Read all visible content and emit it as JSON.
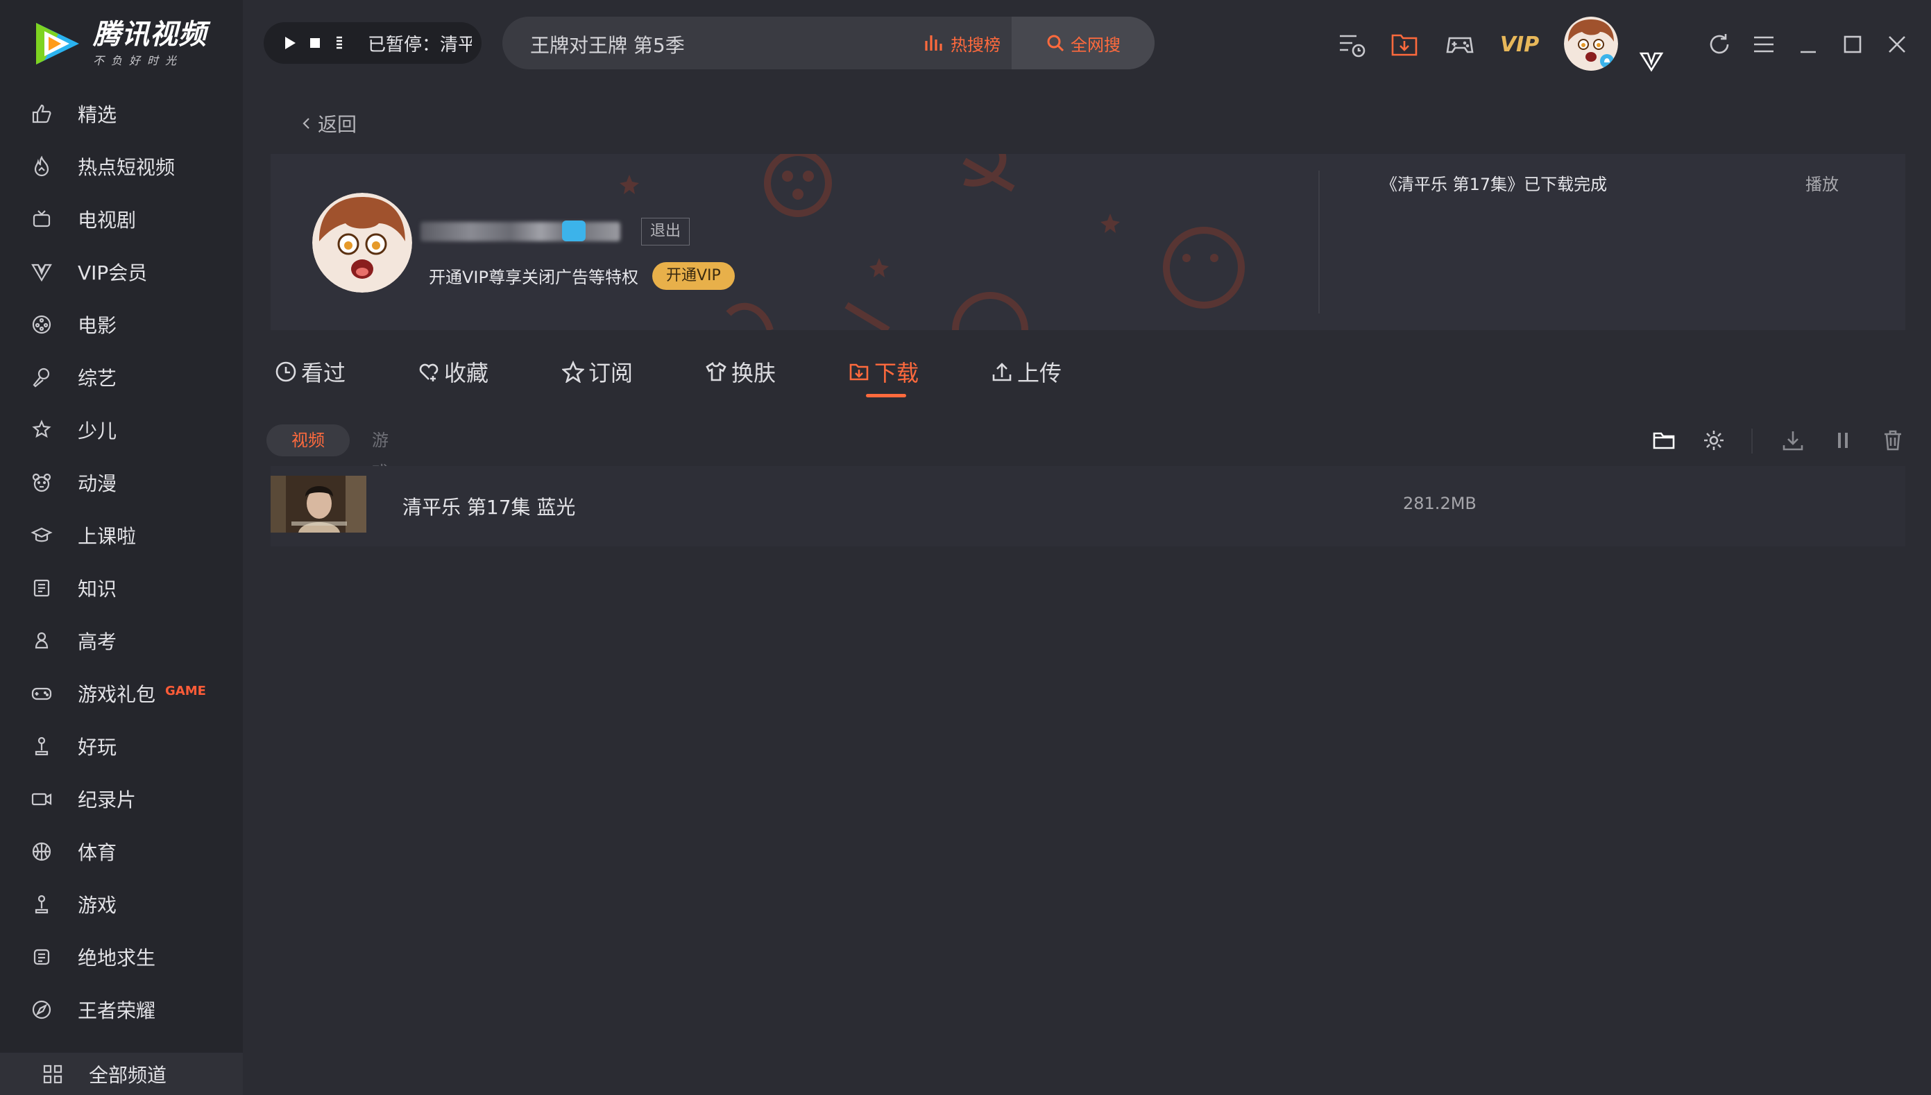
{
  "app": {
    "logo_name": "腾讯视频",
    "logo_slogan": "不负好时光"
  },
  "sidebar": {
    "items": [
      {
        "label": "精选",
        "icon": "thumbs-up-icon"
      },
      {
        "label": "热点短视频",
        "icon": "flame-icon"
      },
      {
        "label": "电视剧",
        "icon": "tv-icon"
      },
      {
        "label": "VIP会员",
        "icon": "vip-diamond-icon"
      },
      {
        "label": "电影",
        "icon": "film-reel-icon"
      },
      {
        "label": "综艺",
        "icon": "microphone-icon"
      },
      {
        "label": "少儿",
        "icon": "kids-icon"
      },
      {
        "label": "动漫",
        "icon": "bear-face-icon"
      },
      {
        "label": "上课啦",
        "icon": "graduation-cap-icon"
      },
      {
        "label": "知识",
        "icon": "book-icon"
      },
      {
        "label": "高考",
        "icon": "exam-icon"
      },
      {
        "label": "游戏礼包",
        "icon": "gamepad-icon",
        "badge": "GAME"
      },
      {
        "label": "好玩",
        "icon": "joystick-icon"
      },
      {
        "label": "纪录片",
        "icon": "camera-icon"
      },
      {
        "label": "体育",
        "icon": "basketball-icon"
      },
      {
        "label": "游戏",
        "icon": "joystick-icon"
      },
      {
        "label": "绝地求生",
        "icon": "helmet-icon"
      },
      {
        "label": "王者荣耀",
        "icon": "compass-icon"
      }
    ],
    "all_channels": "全部频道"
  },
  "player": {
    "status": "已暂停：清平乐"
  },
  "search": {
    "query": "王牌对王牌 第5季",
    "hot_rank_label": "热搜榜",
    "search_button": "全网搜"
  },
  "header": {
    "vip_label": "VIP"
  },
  "main": {
    "back_label": "返回",
    "profile": {
      "logout_label": "退出",
      "vip_tip": "开通VIP尊享关闭广告等特权",
      "open_vip_label": "开通VIP",
      "notice": "《清平乐 第17集》已下载完成",
      "notice_action": "播放"
    },
    "tabs": [
      {
        "label": "看过",
        "icon": "clock-icon"
      },
      {
        "label": "收藏",
        "icon": "heart-plus-icon"
      },
      {
        "label": "订阅",
        "icon": "star-icon"
      },
      {
        "label": "换肤",
        "icon": "tshirt-icon"
      },
      {
        "label": "下载",
        "icon": "download-box-icon",
        "active": true
      },
      {
        "label": "上传",
        "icon": "upload-icon"
      }
    ],
    "subtabs": {
      "active": "视频",
      "other": "游戏"
    },
    "downloads": [
      {
        "title": "清平乐 第17集 蓝光",
        "size": "281.2MB"
      }
    ]
  },
  "colors": {
    "accent": "#ff6a3d",
    "vip_gold": "#e8b04a",
    "background": "#2b2c33",
    "sidebar": "#25262c"
  }
}
